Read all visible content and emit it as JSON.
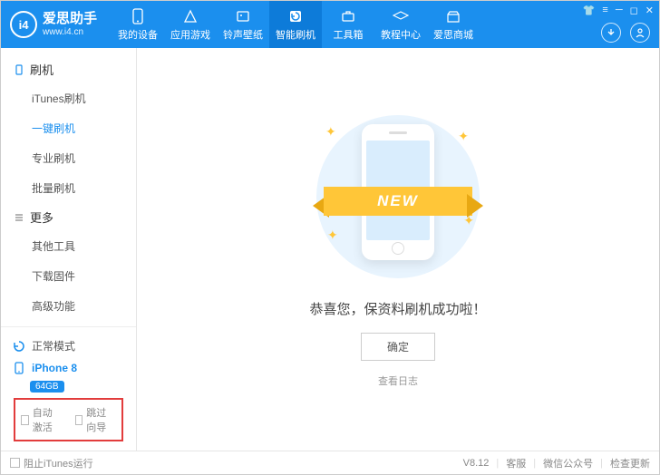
{
  "app": {
    "name": "爱思助手",
    "url": "www.i4.cn"
  },
  "nav": [
    {
      "id": "device",
      "label": "我的设备"
    },
    {
      "id": "apps",
      "label": "应用游戏"
    },
    {
      "id": "ringtone",
      "label": "铃声壁纸"
    },
    {
      "id": "flash",
      "label": "智能刷机",
      "active": true
    },
    {
      "id": "toolbox",
      "label": "工具箱"
    },
    {
      "id": "tutorial",
      "label": "教程中心"
    },
    {
      "id": "store",
      "label": "爱思商城"
    }
  ],
  "sidebar": {
    "group1": {
      "title": "刷机",
      "items": [
        {
          "id": "itunes",
          "label": "iTunes刷机"
        },
        {
          "id": "onekey",
          "label": "一键刷机",
          "active": true
        },
        {
          "id": "pro",
          "label": "专业刷机"
        },
        {
          "id": "batch",
          "label": "批量刷机"
        }
      ]
    },
    "group2": {
      "title": "更多",
      "items": [
        {
          "id": "other",
          "label": "其他工具"
        },
        {
          "id": "firmware",
          "label": "下载固件"
        },
        {
          "id": "advanced",
          "label": "高级功能"
        }
      ]
    },
    "mode": "正常模式",
    "device": "iPhone 8",
    "storage": "64GB",
    "auto_activate": "自动激活",
    "skip_guide": "跳过向导"
  },
  "main": {
    "ribbon": "NEW",
    "message": "恭喜您，保资料刷机成功啦！",
    "ok": "确定",
    "log": "查看日志"
  },
  "footer": {
    "block_itunes": "阻止iTunes运行",
    "version": "V8.12",
    "support": "客服",
    "wechat": "微信公众号",
    "update": "检查更新"
  }
}
